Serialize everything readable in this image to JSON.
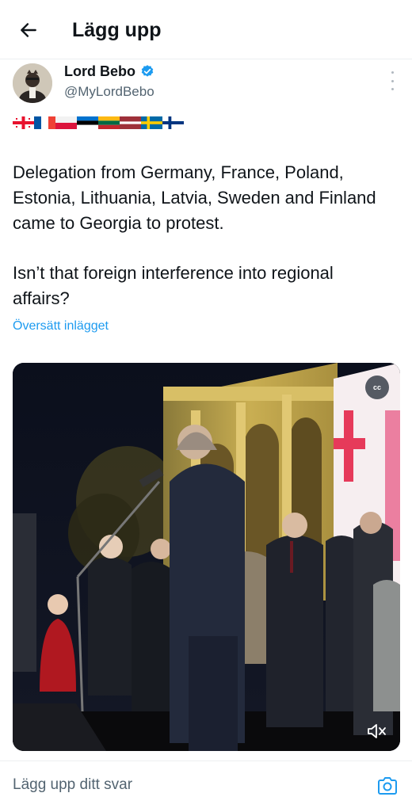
{
  "header": {
    "back_icon": "arrow-left-icon",
    "title": "Lägg upp"
  },
  "author": {
    "name": "Lord Bebo",
    "handle": "@MyLordBebo",
    "verified_color": "#1d9bf0"
  },
  "post": {
    "flags": [
      "georgia",
      "france",
      "poland",
      "estonia",
      "lithuania",
      "latvia",
      "sweden",
      "finland"
    ],
    "paragraph1": "Delegation from Germany, France, Poland, Estonia, Lithuania, Latvia, Sweden and Finland came to Georgia to protest.",
    "paragraph2": "Isn’t that foreign interference into regional affairs?",
    "translate_label": "Översätt inlägget"
  },
  "media": {
    "cc_label": "cc",
    "mute_icon": "speaker-muted-icon"
  },
  "reply": {
    "placeholder": "Lägg upp ditt svar",
    "camera_icon": "camera-icon"
  },
  "colors": {
    "accent": "#1d9bf0",
    "text": "#0f1419",
    "muted": "#536471"
  }
}
